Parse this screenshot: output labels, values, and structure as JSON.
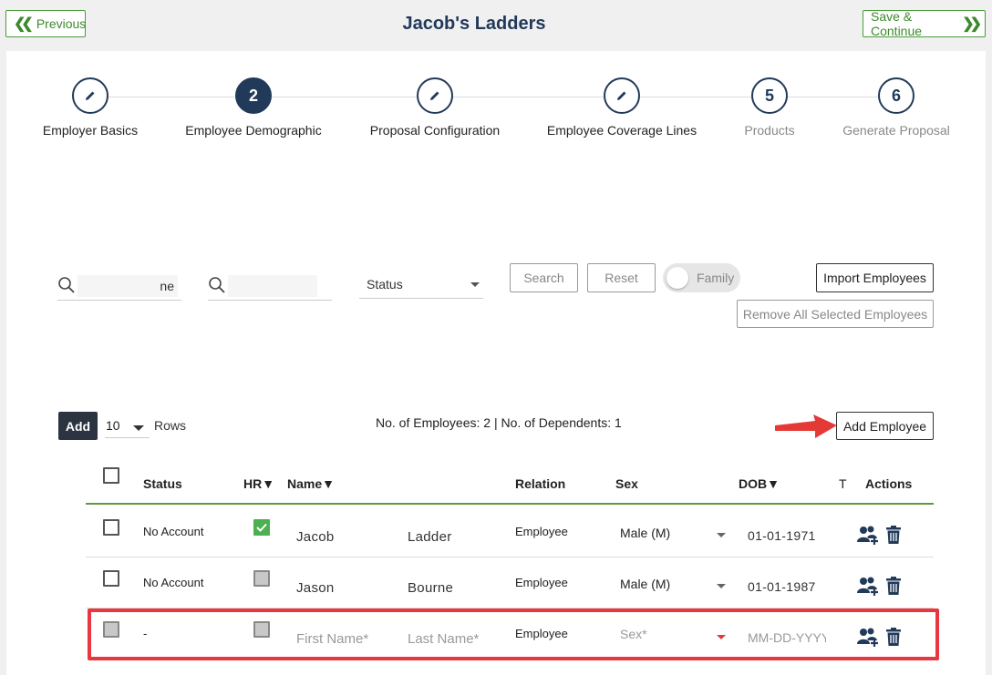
{
  "header": {
    "previous_label": "Previous",
    "title": "Jacob's Ladders",
    "save_label": "Save & Continue"
  },
  "stepper": {
    "steps": [
      {
        "number": "",
        "icon": "pencil-icon",
        "label": "Employer Basics",
        "state": "done"
      },
      {
        "number": "2",
        "icon": "",
        "label": "Employee Demographic",
        "state": "active"
      },
      {
        "number": "",
        "icon": "pencil-icon",
        "label": "Proposal Configuration",
        "state": "done"
      },
      {
        "number": "",
        "icon": "pencil-icon",
        "label": "Employee Coverage Lines",
        "state": "done"
      },
      {
        "number": "5",
        "icon": "",
        "label": "Products",
        "state": "future"
      },
      {
        "number": "6",
        "icon": "",
        "label": "Generate Proposal",
        "state": "future"
      }
    ]
  },
  "filters": {
    "search1_value": "ne",
    "search2_value": "",
    "status_label": "Status",
    "search_label": "Search",
    "reset_label": "Reset",
    "family_label": "Family",
    "import_label": "Import Employees",
    "remove_all_label": "Remove All Selected Employees"
  },
  "table_controls": {
    "add_label": "Add",
    "rows_value": "10",
    "rows_label": "Rows",
    "counts_text": "No. of Employees: 2 | No. of Dependents: 1",
    "add_employee_label": "Add Employee"
  },
  "table": {
    "headers": {
      "status": "Status",
      "hr": "HR▼",
      "name": "Name▼",
      "relation": "Relation",
      "sex": "Sex",
      "dob": "DOB▼",
      "t": "T",
      "actions": "Actions"
    },
    "rows": [
      {
        "status": "No Account",
        "hr_checked": true,
        "first": "Jacob",
        "last": "Ladder",
        "relation": "Employee",
        "sex": "Male (M)",
        "dob": "01-01-1971"
      },
      {
        "status": "No Account",
        "hr_checked": false,
        "first": "Jason",
        "last": "Bourne",
        "relation": "Employee",
        "sex": "Male (M)",
        "dob": "01-01-1987"
      }
    ],
    "new_row": {
      "status": "-",
      "first_placeholder": "First Name*",
      "last_placeholder": "Last Name*",
      "relation": "Employee",
      "sex_placeholder": "Sex*",
      "dob_placeholder": "MM-DD-YYYY"
    }
  },
  "colors": {
    "brand_navy": "#223a5a",
    "success_green": "#4caf50",
    "highlight_red": "#e8373f"
  }
}
